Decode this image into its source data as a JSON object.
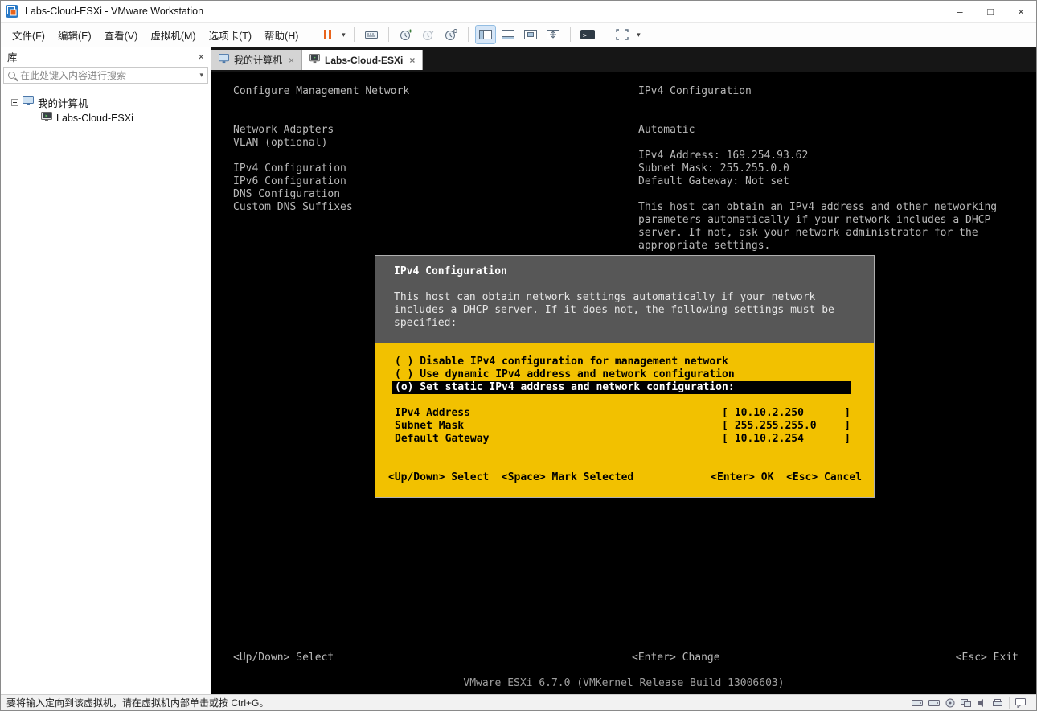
{
  "colors": {
    "dcui_yellow": "#F2C100",
    "dcui_dialog_gray": "#575757",
    "console_text_gray": "#B9B9B9",
    "highlight_row_bg": "#000000",
    "toolbar_accent_orange": "#E8641C"
  },
  "icons": {
    "minimize": "–",
    "maximize": "□",
    "close": "×",
    "caret_down": "▾",
    "terminal": ">_",
    "tab_close": "×",
    "panel_close": "×"
  },
  "window": {
    "title": "Labs-Cloud-ESXi - VMware Workstation"
  },
  "menubar": {
    "items": [
      "文件(F)",
      "编辑(E)",
      "查看(V)",
      "虚拟机(M)",
      "选项卡(T)",
      "帮助(H)"
    ]
  },
  "sidebar": {
    "title": "库",
    "search_placeholder": "在此处键入内容进行搜索",
    "tree_root": "我的计算机",
    "tree_child": "Labs-Cloud-ESXi"
  },
  "tabs": {
    "tab1": "我的计算机",
    "tab2": "Labs-Cloud-ESXi"
  },
  "console": {
    "left_title": "Configure Management Network",
    "right_title": "IPv4 Configuration",
    "menu_items": [
      "Network Adapters",
      "VLAN (optional)",
      "",
      "IPv4 Configuration",
      "IPv6 Configuration",
      "DNS Configuration",
      "Custom DNS Suffixes"
    ],
    "mode": "Automatic",
    "ip_lines": [
      "IPv4 Address: 169.254.93.62",
      "Subnet Mask: 255.255.0.0",
      "Default Gateway: Not set"
    ],
    "description": [
      "This host can obtain an IPv4 address and other networking",
      "parameters automatically if your network includes a DHCP",
      "server. If not, ask your network administrator for the",
      "appropriate settings."
    ],
    "hint_left": "<Up/Down> Select",
    "hint_center": "<Enter> Change",
    "hint_right": "<Esc> Exit",
    "version": "VMware ESXi 6.7.0 (VMKernel Release Build 13006603)"
  },
  "dialog": {
    "title": "IPv4 Configuration",
    "description": [
      "This host can obtain network settings automatically if your network",
      "includes a DHCP server. If it does not, the following settings must be",
      "specified:"
    ],
    "options": [
      {
        "text": "( ) Disable IPv4 configuration for management network",
        "selected": false
      },
      {
        "text": "( ) Use dynamic IPv4 address and network configuration",
        "selected": false
      },
      {
        "text": "(o) Set static IPv4 address and network configuration:",
        "selected": true
      }
    ],
    "fields": [
      {
        "label": "IPv4 Address",
        "value": "10.10.2.250"
      },
      {
        "label": "Subnet Mask",
        "value": "255.255.255.0"
      },
      {
        "label": "Default Gateway",
        "value": "10.10.2.254"
      }
    ],
    "bracket_open": "[",
    "bracket_close": "]",
    "hints_left": "<Up/Down> Select  <Space> Mark Selected",
    "hints_right": "<Enter> OK  <Esc> Cancel"
  },
  "statusbar": {
    "message": "要将输入定向到该虚拟机，请在虚拟机内部单击或按 Ctrl+G。"
  }
}
